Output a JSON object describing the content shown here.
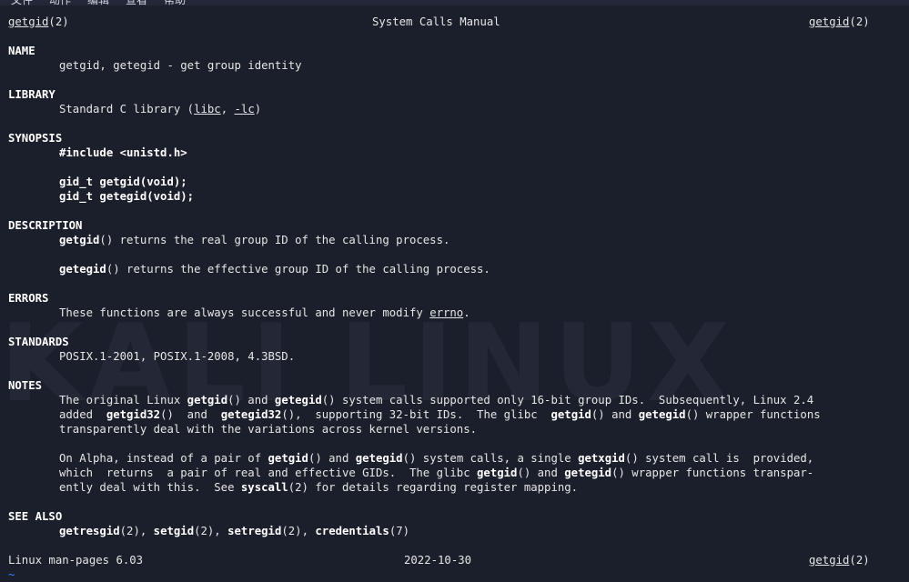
{
  "menubar": [
    "文件",
    "动作",
    "编辑",
    "查看",
    "帮助"
  ],
  "header": {
    "left_cmd": "getgid",
    "left_suffix": "(2)",
    "center": "System Calls Manual",
    "right_cmd": "getgid",
    "right_suffix": "(2)"
  },
  "sections": {
    "name": {
      "heading": "NAME",
      "text": "getgid, getegid - get group identity"
    },
    "library": {
      "heading": "LIBRARY",
      "pre": "Standard C library (",
      "libc": "libc",
      "mid": ", ",
      "lc": "-lc",
      "post": ")"
    },
    "synopsis": {
      "heading": "SYNOPSIS",
      "include": "#include <unistd.h>",
      "proto1": "gid_t getgid(void);",
      "proto2": "gid_t getegid(void);"
    },
    "description": {
      "heading": "DESCRIPTION",
      "p1_fn": "getgid",
      "p1_rest": "() returns the real group ID of the calling process.",
      "p2_fn": "getegid",
      "p2_rest": "() returns the effective group ID of the calling process."
    },
    "errors": {
      "heading": "ERRORS",
      "pre": "These functions are always successful and never modify ",
      "errno": "errno",
      "post": "."
    },
    "standards": {
      "heading": "STANDARDS",
      "text": "POSIX.1-2001, POSIX.1-2008, 4.3BSD."
    },
    "notes": {
      "heading": "NOTES",
      "l1_a": "The original Linux ",
      "l1_b": "getgid",
      "l1_c": "() and ",
      "l1_d": "getegid",
      "l1_e": "() system calls supported only 16-bit group IDs.  Subsequently, Linux 2.4",
      "l2_a": "added  ",
      "l2_b": "getgid32",
      "l2_c": "()  and  ",
      "l2_d": "getegid32",
      "l2_e": "(),  supporting 32-bit IDs.  The glibc  ",
      "l2_f": "getgid",
      "l2_g": "() and ",
      "l2_h": "getegid",
      "l2_i": "() wrapper functions",
      "l3": "transparently deal with the variations across kernel versions.",
      "l4_a": "On Alpha, instead of a pair of ",
      "l4_b": "getgid",
      "l4_c": "() and ",
      "l4_d": "getegid",
      "l4_e": "() system calls, a single ",
      "l4_f": "getxgid",
      "l4_g": "() system call is  provided,",
      "l5_a": "which  returns  a pair of real and effective GIDs.  The glibc ",
      "l5_b": "getgid",
      "l5_c": "() and ",
      "l5_d": "getegid",
      "l5_e": "() wrapper functions transpar-",
      "l6_a": "ently deal with this.  See ",
      "l6_b": "syscall",
      "l6_c": "(2) for details regarding register mapping."
    },
    "see_also": {
      "heading": "SEE ALSO",
      "a": "getresgid",
      "a2": "(2), ",
      "b": "setgid",
      "b2": "(2), ",
      "c": "setregid",
      "c2": "(2), ",
      "d": "credentials",
      "d2": "(7)"
    }
  },
  "footer": {
    "left": "Linux man-pages 6.03",
    "center": "2022-10-30",
    "right_cmd": "getgid",
    "right_suffix": "(2)"
  },
  "prompt": "~",
  "watermark": "KALI LINUX"
}
